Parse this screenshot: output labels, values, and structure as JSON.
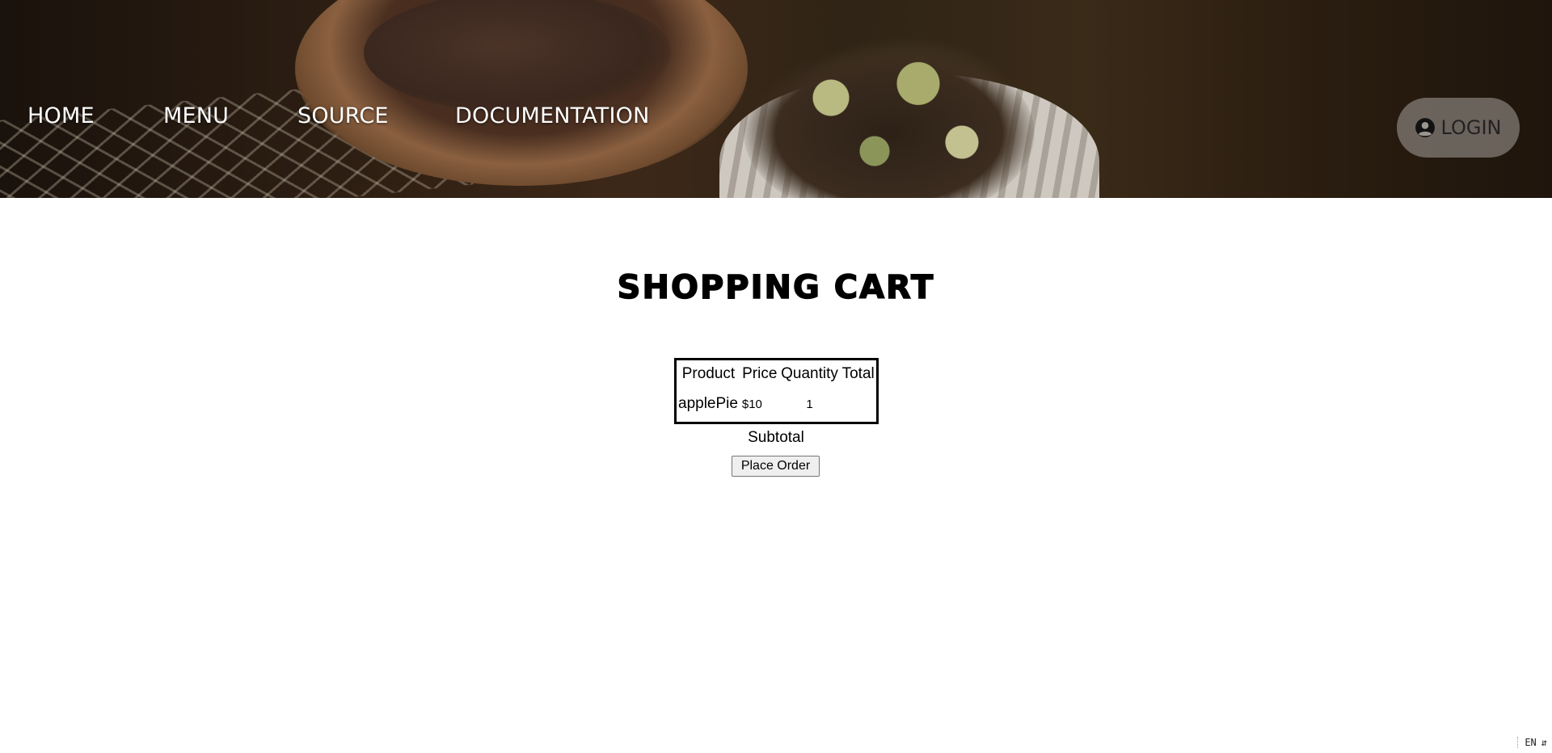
{
  "nav": {
    "links": [
      {
        "label": "HOME"
      },
      {
        "label": "MENU"
      },
      {
        "label": "SOURCE"
      },
      {
        "label": "DOCUMENTATION"
      }
    ],
    "login_label": "LOGIN",
    "login_icon": "user-circle-icon"
  },
  "cart": {
    "title": "SHOPPING CART",
    "columns": [
      "Product",
      "Price",
      "Quantity",
      "Total"
    ],
    "rows": [
      {
        "product": "applePie",
        "price": "$10",
        "quantity": "1",
        "total": ""
      }
    ],
    "subtotal_label": "Subtotal",
    "place_order_label": "Place Order"
  },
  "system": {
    "language": "EN"
  }
}
